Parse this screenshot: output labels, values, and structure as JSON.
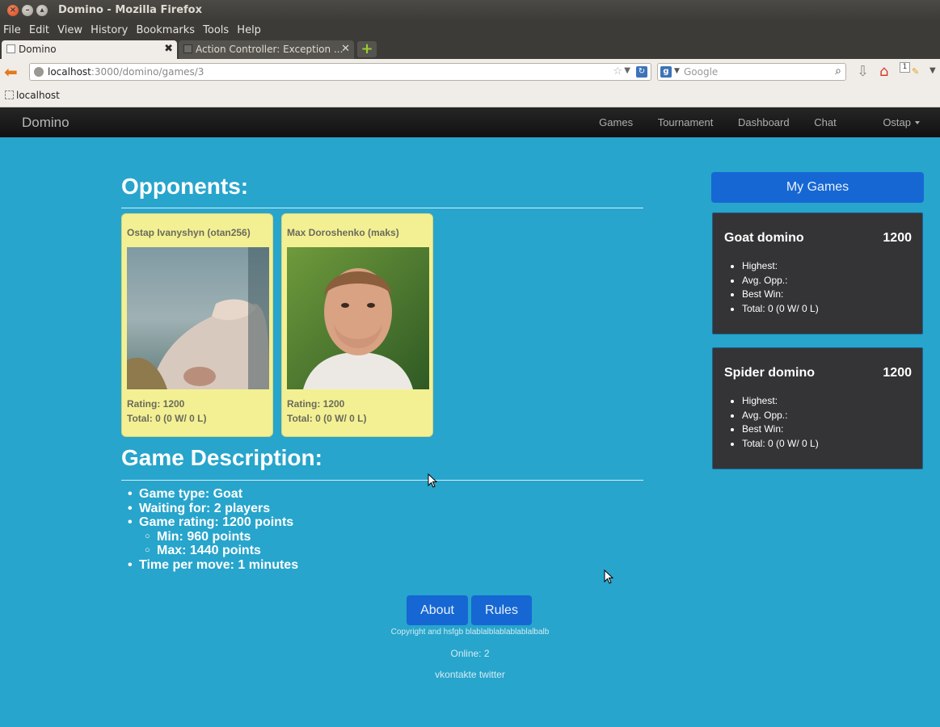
{
  "window": {
    "title": "Domino - Mozilla Firefox"
  },
  "menubar": [
    "File",
    "Edit",
    "View",
    "History",
    "Bookmarks",
    "Tools",
    "Help"
  ],
  "tabs": [
    {
      "label": "Domino",
      "active": true
    },
    {
      "label": "Action Controller: Exception ...",
      "active": false
    }
  ],
  "toolbar": {
    "url_host": "localhost",
    "url_path": ":3000/domino/games/3",
    "search_placeholder": "Google",
    "badge_count": "1"
  },
  "bookmarks": [
    {
      "label": "localhost"
    }
  ],
  "site": {
    "brand": "Domino",
    "nav": [
      "Games",
      "Tournament",
      "Dashboard",
      "Chat",
      "Ostap"
    ]
  },
  "opponents": {
    "heading": "Opponents:",
    "players": [
      {
        "name": "Ostap Ivanyshyn (otan256)",
        "rating": "Rating: 1200",
        "total": "Total: 0 (0 W/ 0 L)"
      },
      {
        "name": "Max Doroshenko (maks)",
        "rating": "Rating: 1200",
        "total": "Total: 0 (0 W/ 0 L)"
      }
    ]
  },
  "description": {
    "heading": "Game Description:",
    "type": "Game type: Goat",
    "waiting": "Waiting for: 2 players",
    "rating": "Game rating: 1200 points",
    "min": "Min: 960 points",
    "max": "Max: 1440 points",
    "time": "Time per move: 1 minutes"
  },
  "sidebar": {
    "my_games_label": "My Games",
    "games": [
      {
        "title": "Goat domino",
        "score": "1200",
        "highest": "Highest:",
        "avg": "Avg. Opp.:",
        "best": "Best Win:",
        "total": "Total: 0 (0 W/ 0 L)"
      },
      {
        "title": "Spider domino",
        "score": "1200",
        "highest": "Highest:",
        "avg": "Avg. Opp.:",
        "best": "Best Win:",
        "total": "Total: 0 (0 W/ 0 L)"
      }
    ]
  },
  "footer": {
    "about_label": "About",
    "rules_label": "Rules",
    "copyright": "Copyright and hsfgb blablalblablablablalbalb",
    "online": "Online: 2",
    "social": "vkontakte twitter"
  },
  "colors": {
    "page_bg": "#27a5cc",
    "button_blue": "#1667d3",
    "card_yellow": "#f3f094",
    "sidebar_box": "#343436"
  }
}
